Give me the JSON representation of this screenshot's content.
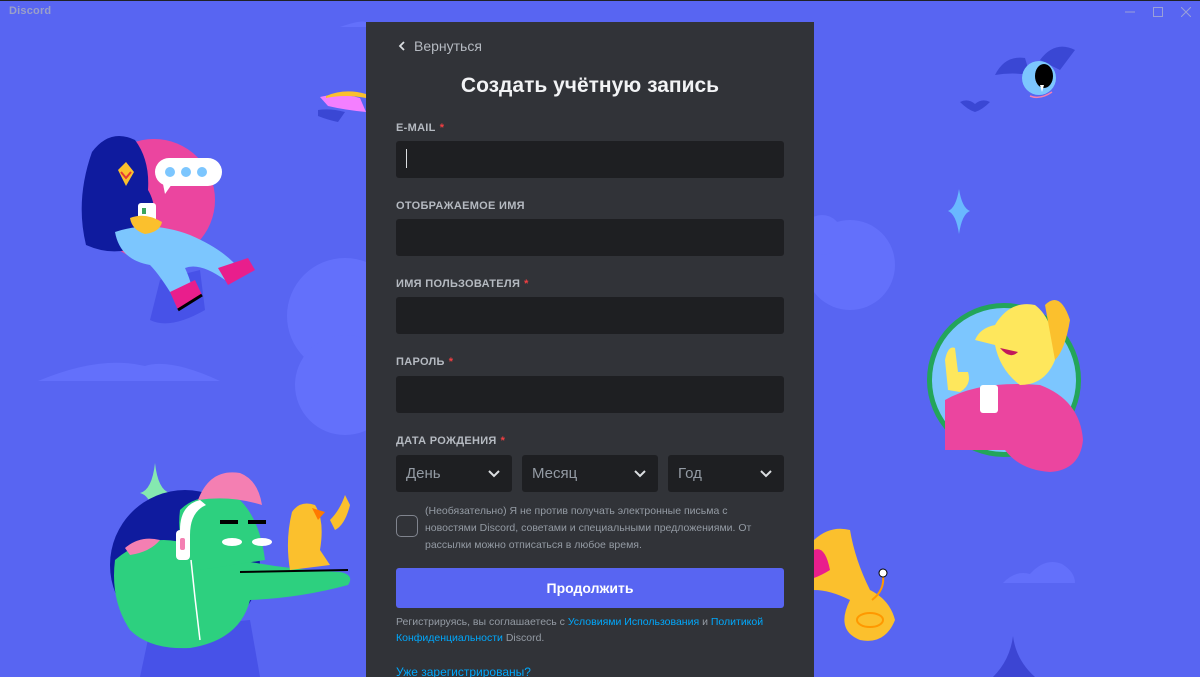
{
  "window": {
    "app_title": "Discord",
    "controls": [
      "minimize",
      "maximize",
      "close"
    ]
  },
  "form": {
    "back_label": "Вернуться",
    "title": "Создать учётную запись",
    "fields": {
      "email": {
        "label": "E-MAIL",
        "required": "*",
        "value": "",
        "placeholder": ""
      },
      "display_name": {
        "label": "Отображаемое имя",
        "value": "",
        "placeholder": ""
      },
      "username": {
        "label": "Имя пользователя",
        "required": "*",
        "value": "",
        "placeholder": ""
      },
      "password": {
        "label": "Пароль",
        "required": "*",
        "value": "",
        "placeholder": ""
      }
    },
    "birthdate": {
      "label": "Дата рождения",
      "required": "*",
      "day": "День",
      "month": "Месяц",
      "year": "Год"
    },
    "newsletter": {
      "checked": false,
      "text": "(Необязательно) Я не против получать электронные письма с новостями Discord, советами и специальными предложениями. От рассылки можно отписаться в любое время."
    },
    "continue_label": "Продолжить",
    "terms": {
      "prefix": "Регистрируясь, вы соглашаетесь с ",
      "tos_link": "Условиями Использования",
      "middle": " и ",
      "privacy_link": "Политикой Конфиденциальности",
      "suffix": " Discord."
    },
    "login_link": "Уже зарегистрированы?"
  },
  "colors": {
    "background": "#5865f2",
    "card": "#313338",
    "input": "#1e1f22",
    "accent": "#5865f2",
    "link": "#00a8fc",
    "required": "#f23f42"
  }
}
